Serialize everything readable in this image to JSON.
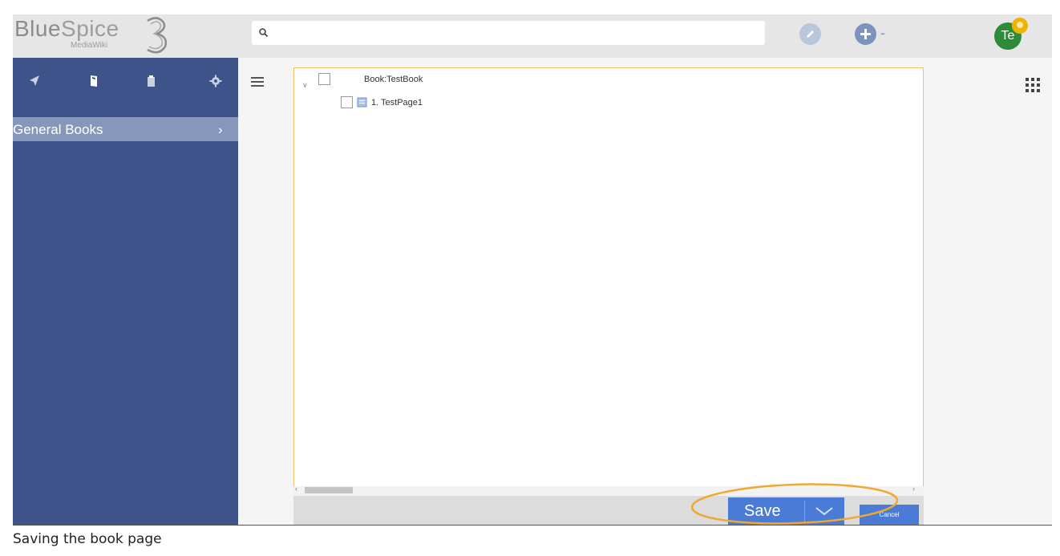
{
  "header": {
    "logo": "BlueSpice 3 MediaWiki",
    "logo_main_blue": "Blue",
    "logo_main_spice": "Spice",
    "logo_sub": "MediaWiki",
    "search_value": "",
    "avatar_initials": "Te"
  },
  "sidebar": {
    "tabs": [
      {
        "icon": "navigation-icon"
      },
      {
        "icon": "book-icon"
      },
      {
        "icon": "clipboard-icon"
      },
      {
        "icon": "gear-icon"
      }
    ],
    "active_item": "General Books",
    "active_chevron": "›"
  },
  "tree": {
    "root": "Book:TestBook",
    "children": [
      "1. TestPage1"
    ]
  },
  "buttons": {
    "save": "Save",
    "cancel": "Cancel"
  },
  "caption": "Saving the book page",
  "colors": {
    "sidebar": "#3e5389",
    "primary": "#4a7bd7",
    "highlight": "#f0a830",
    "avatar": "#2e8b3a",
    "badge": "#f2b200"
  }
}
